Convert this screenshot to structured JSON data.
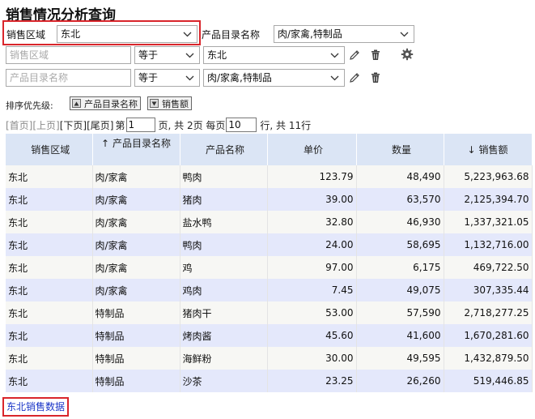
{
  "page": {
    "title": "销售情况分析查询"
  },
  "filter_row1": {
    "region_label": "销售区域",
    "region_value": "东北",
    "category_label": "产品目录名称",
    "category_value": "肉/家禽,特制品"
  },
  "filter_row2": {
    "field_placeholder": "销售区域",
    "operator": "等于",
    "value": "东北"
  },
  "filter_row3": {
    "field_placeholder": "产品目录名称",
    "operator": "等于",
    "value": "肉/家禽,特制品"
  },
  "sort": {
    "label": "排序优先级:",
    "chips": [
      "产品目录名称",
      "销售额"
    ]
  },
  "pager": {
    "first": "[首页]",
    "prev": "[上页]",
    "next": "[下页]",
    "last": "[尾页]",
    "page_prefix": "第",
    "current_page": "1",
    "page_mid": "页, 共 2页 每页",
    "page_size": "10",
    "page_suffix": "行, 共 11行"
  },
  "table": {
    "headers": [
      "销售区域",
      "产品目录名称",
      "产品名称",
      "单价",
      "数量",
      "销售额"
    ],
    "header_sort": [
      "",
      "↑",
      "",
      "",
      "",
      "↓"
    ],
    "rows": [
      [
        "东北",
        "肉/家禽",
        "鸭肉",
        "123.79",
        "48,490",
        "5,223,963.68"
      ],
      [
        "东北",
        "肉/家禽",
        "猪肉",
        "39.00",
        "63,570",
        "2,125,394.70"
      ],
      [
        "东北",
        "肉/家禽",
        "盐水鸭",
        "32.80",
        "46,930",
        "1,337,321.05"
      ],
      [
        "东北",
        "肉/家禽",
        "鸭肉",
        "24.00",
        "58,695",
        "1,132,716.00"
      ],
      [
        "东北",
        "肉/家禽",
        "鸡",
        "97.00",
        "6,175",
        "469,722.50"
      ],
      [
        "东北",
        "肉/家禽",
        "鸡肉",
        "7.45",
        "49,075",
        "307,335.44"
      ],
      [
        "东北",
        "特制品",
        "猪肉干",
        "53.00",
        "57,590",
        "2,718,277.25"
      ],
      [
        "东北",
        "特制品",
        "烤肉酱",
        "45.60",
        "41,600",
        "1,670,281.60"
      ],
      [
        "东北",
        "特制品",
        "海鲜粉",
        "30.00",
        "49,595",
        "1,432,879.50"
      ],
      [
        "东北",
        "特制品",
        "沙茶",
        "23.25",
        "26,260",
        "519,446.85"
      ]
    ]
  },
  "footer": {
    "link": "东北销售数据"
  },
  "colors": {
    "highlight": "#d9252b",
    "header_bg": "#dbe5f5",
    "row_alt": "#e4e8fb",
    "link": "#1a35c8"
  },
  "icons": [
    "chevron-down-icon",
    "pencil-icon",
    "trash-icon",
    "gear-icon",
    "sort-asc-icon",
    "sort-desc-icon"
  ]
}
